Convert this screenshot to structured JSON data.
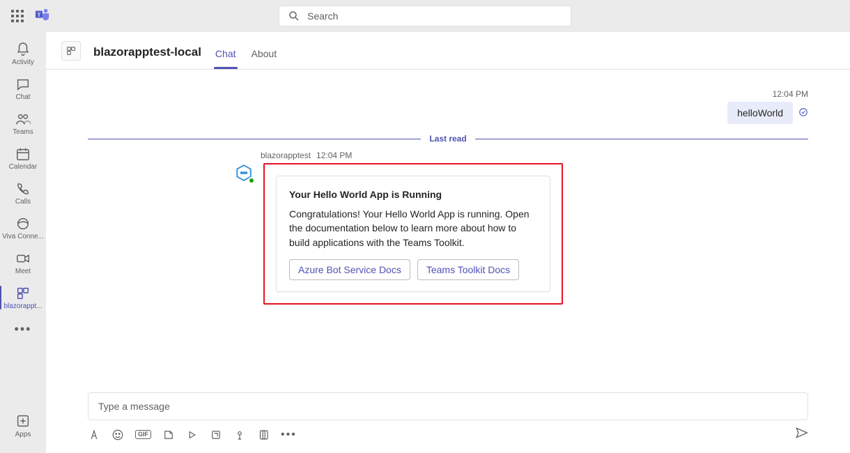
{
  "search": {
    "placeholder": "Search"
  },
  "apprail": {
    "items": [
      {
        "id": "activity",
        "label": "Activity"
      },
      {
        "id": "chat",
        "label": "Chat"
      },
      {
        "id": "teams",
        "label": "Teams"
      },
      {
        "id": "calendar",
        "label": "Calendar"
      },
      {
        "id": "calls",
        "label": "Calls"
      },
      {
        "id": "viva",
        "label": "Viva Conne..."
      },
      {
        "id": "meet",
        "label": "Meet"
      },
      {
        "id": "blazor",
        "label": "blazorappt..."
      }
    ],
    "apps_label": "Apps",
    "more_label": "..."
  },
  "header": {
    "title": "blazorapptest-local",
    "tabs": {
      "chat": "Chat",
      "about": "About"
    }
  },
  "chat": {
    "out": {
      "time": "12:04 PM",
      "text": "helloWorld"
    },
    "last_read": "Last read",
    "bot": {
      "name": "blazorapptest",
      "time": "12:04 PM",
      "card": {
        "title": "Your Hello World App is Running",
        "body": "Congratulations! Your Hello World App is running. Open the documentation below to learn more about how to build applications with the Teams Toolkit.",
        "actions": {
          "azure": "Azure Bot Service Docs",
          "toolkit": "Teams Toolkit Docs"
        }
      }
    }
  },
  "composer": {
    "placeholder": "Type a message",
    "gif": "GIF"
  }
}
